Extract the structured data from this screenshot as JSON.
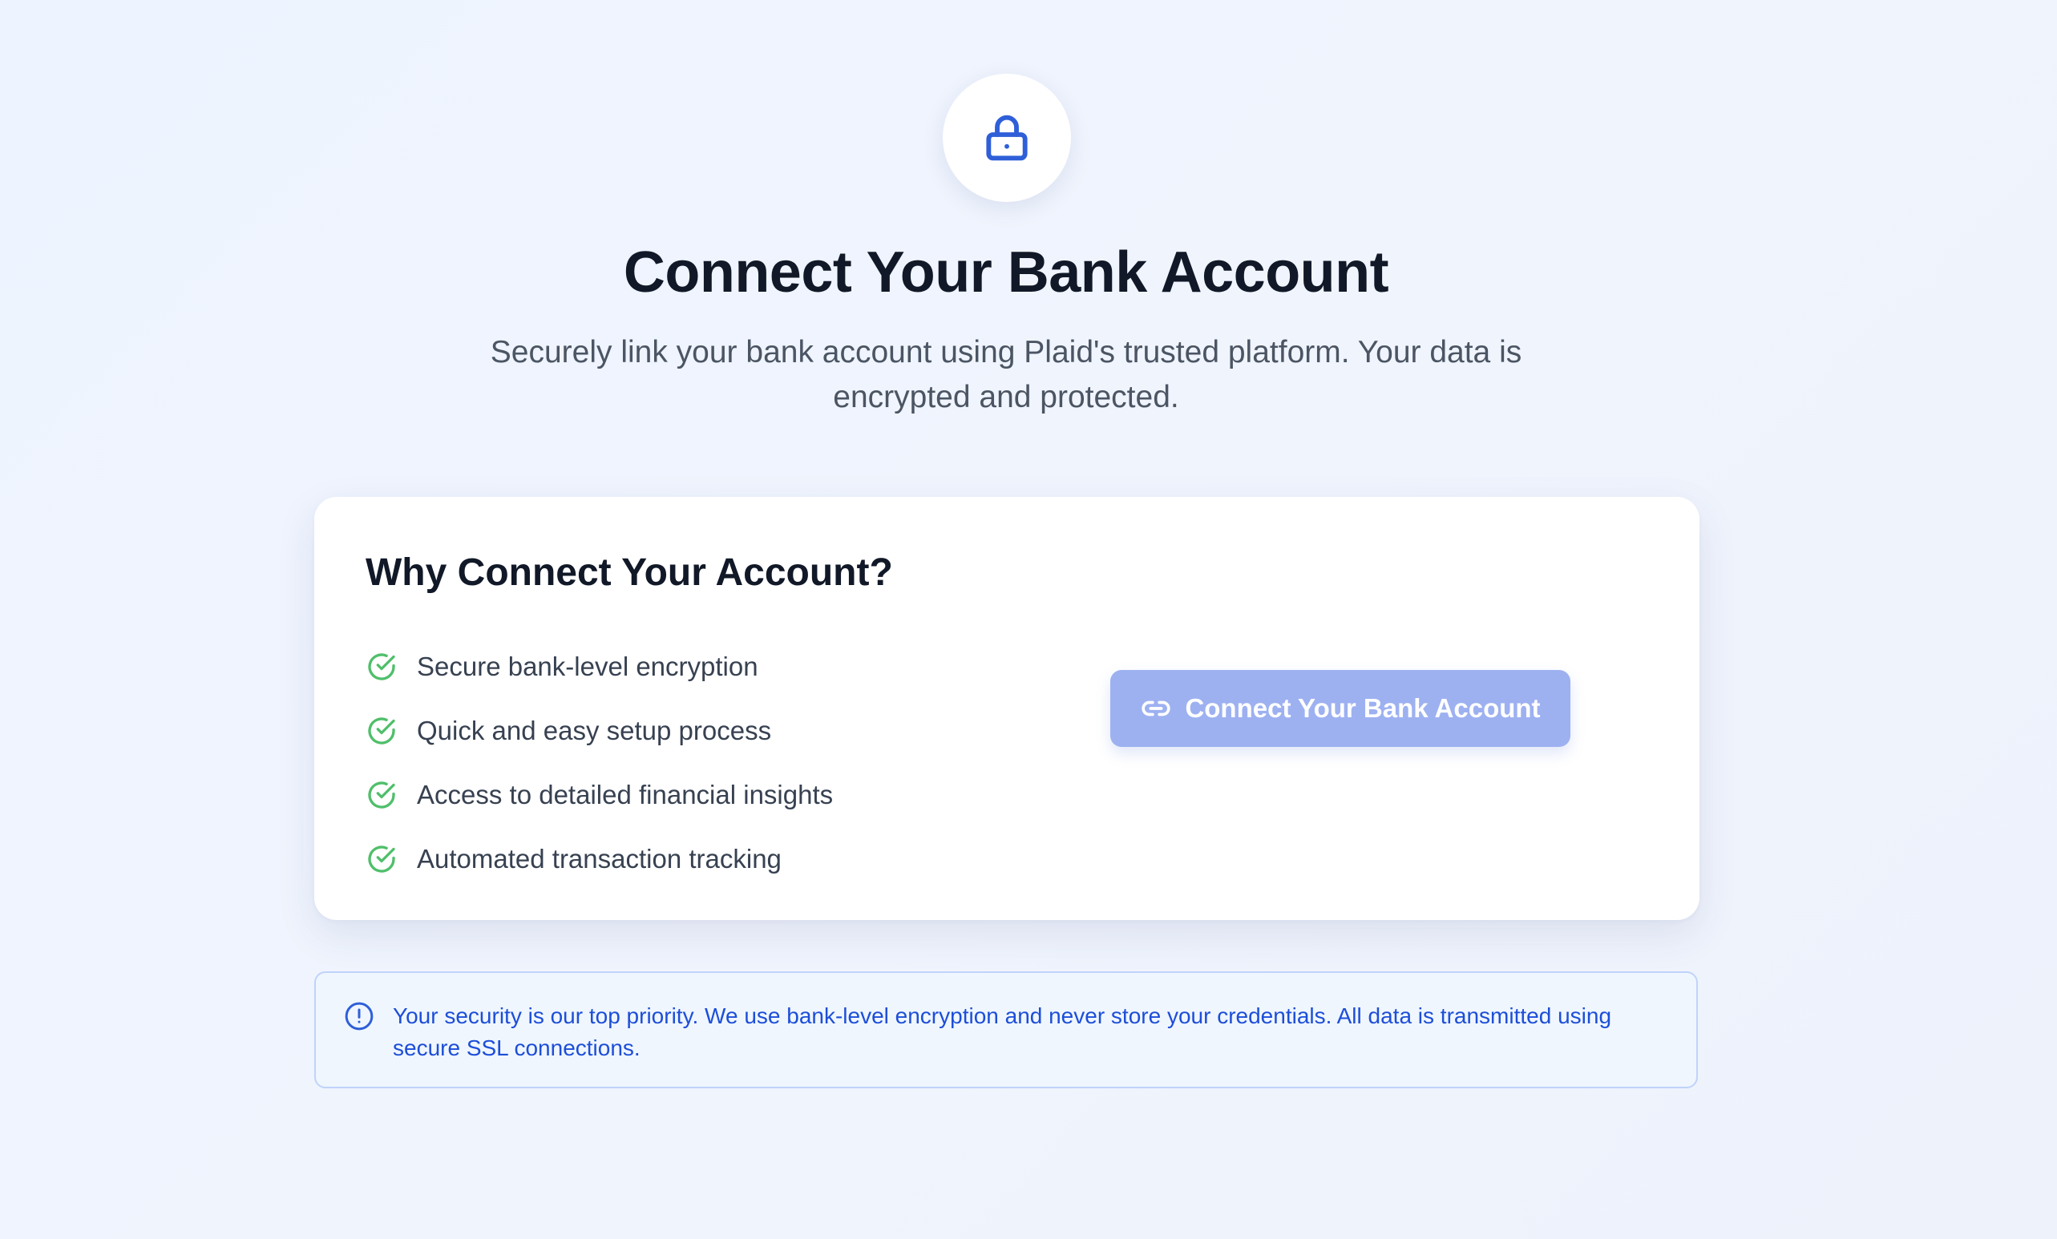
{
  "header": {
    "icon": "lock-icon",
    "title": "Connect Your Bank Account",
    "subtitle": "Securely link your bank account using Plaid's trusted platform. Your data is encrypted and protected."
  },
  "card": {
    "title": "Why Connect Your Account?",
    "features": [
      "Secure bank-level encryption",
      "Quick and easy setup process",
      "Access to detailed financial insights",
      "Automated transaction tracking"
    ],
    "feature_icon": "check-circle-icon",
    "button_label": "Connect Your Bank Account",
    "button_icon": "link-icon"
  },
  "notice": {
    "icon": "info-icon",
    "text": "Your security is our top priority. We use bank-level encryption and never store your credentials. All data is transmitted using secure SSL connections."
  },
  "colors": {
    "accent": "#2f5fd8",
    "button_bg": "#9db1f1",
    "check": "#4fbf6a",
    "notice_text": "#1d4ed8",
    "notice_border": "#bfd3fb",
    "notice_bg": "#eff6fe"
  }
}
